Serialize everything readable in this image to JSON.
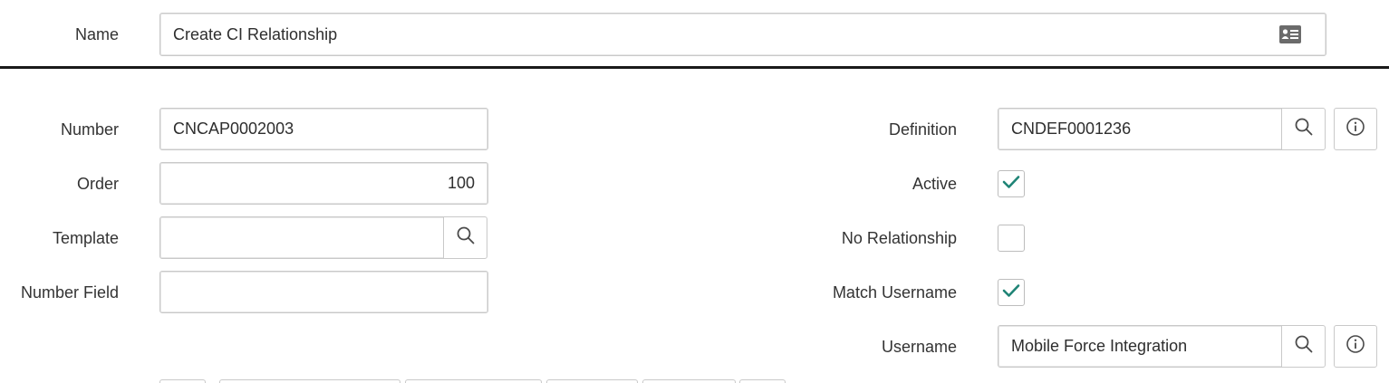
{
  "header": {
    "name_label": "Name",
    "name_value": "Create CI Relationship",
    "name_icon": "card-icon"
  },
  "left": {
    "number_label": "Number",
    "number_value": "CNCAP0002003",
    "order_label": "Order",
    "order_value": "100",
    "template_label": "Template",
    "template_value": "",
    "number_field_label": "Number Field",
    "number_field_value": ""
  },
  "right": {
    "definition_label": "Definition",
    "definition_value": "CNDEF0001236",
    "active_label": "Active",
    "active_checked": true,
    "no_relationship_label": "No Relationship",
    "no_relationship_checked": false,
    "match_username_label": "Match Username",
    "match_username_checked": true,
    "username_label": "Username",
    "username_value": "Mobile Force Integration"
  },
  "colors": {
    "check": "#1f8476",
    "icon": "#4a4a4a",
    "divider": "#1a1a1a"
  }
}
